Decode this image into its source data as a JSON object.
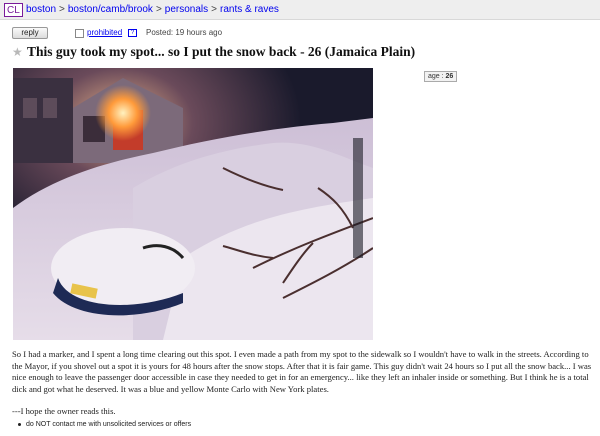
{
  "header": {
    "logo": "CL",
    "breadcrumbs": [
      "boston",
      "boston/camb/brook",
      "personals",
      "rants & raves"
    ]
  },
  "meta": {
    "reply_label": "reply",
    "prohibited_label": "prohibited",
    "prohibited_icon": "?",
    "posted": "Posted: 19 hours ago"
  },
  "post": {
    "title": "This guy took my spot... so I put the snow back - 26 (Jamaica Plain)",
    "age_label": "age :",
    "age_value": "26",
    "body": "So I had a marker, and I spent a long time clearing out this spot. I even made a path from my spot to the sidewalk so I wouldn't have to walk in the streets. According to the Mayor, if you shovel out a spot it is yours for 48 hours after the snow stops. After that it is fair game. This guy didn't wait 24 hours so I put all the snow back... I was nice enough to leave the passenger door accessible in case they needed to get in for an emergency... like they left an inhaler inside or something. But I think he is a total dick and got what he deserved. It was a blue and yellow Monte Carlo with New York plates.",
    "signoff": "---I hope the owner reads this.",
    "notice": "do NOT contact me with unsolicited services or offers"
  },
  "icons": {
    "favorite": "star-icon"
  },
  "colors": {
    "link": "#0000ee",
    "logo": "#7a1a9a",
    "topbar": "#eeeeee"
  }
}
